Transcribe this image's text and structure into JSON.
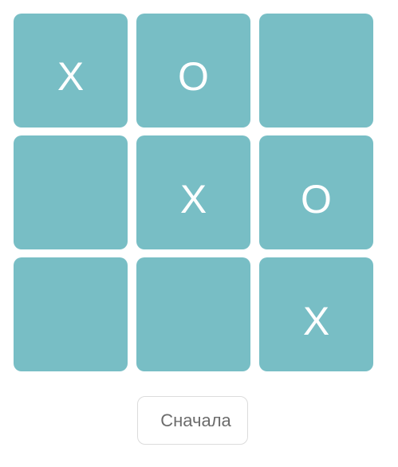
{
  "board": {
    "cells": [
      "X",
      "O",
      "",
      "",
      "X",
      "O",
      "",
      "",
      "X"
    ],
    "cell_color": "#78bec5",
    "mark_color": "#ffffff"
  },
  "controls": {
    "restart_label": "Сначала"
  }
}
